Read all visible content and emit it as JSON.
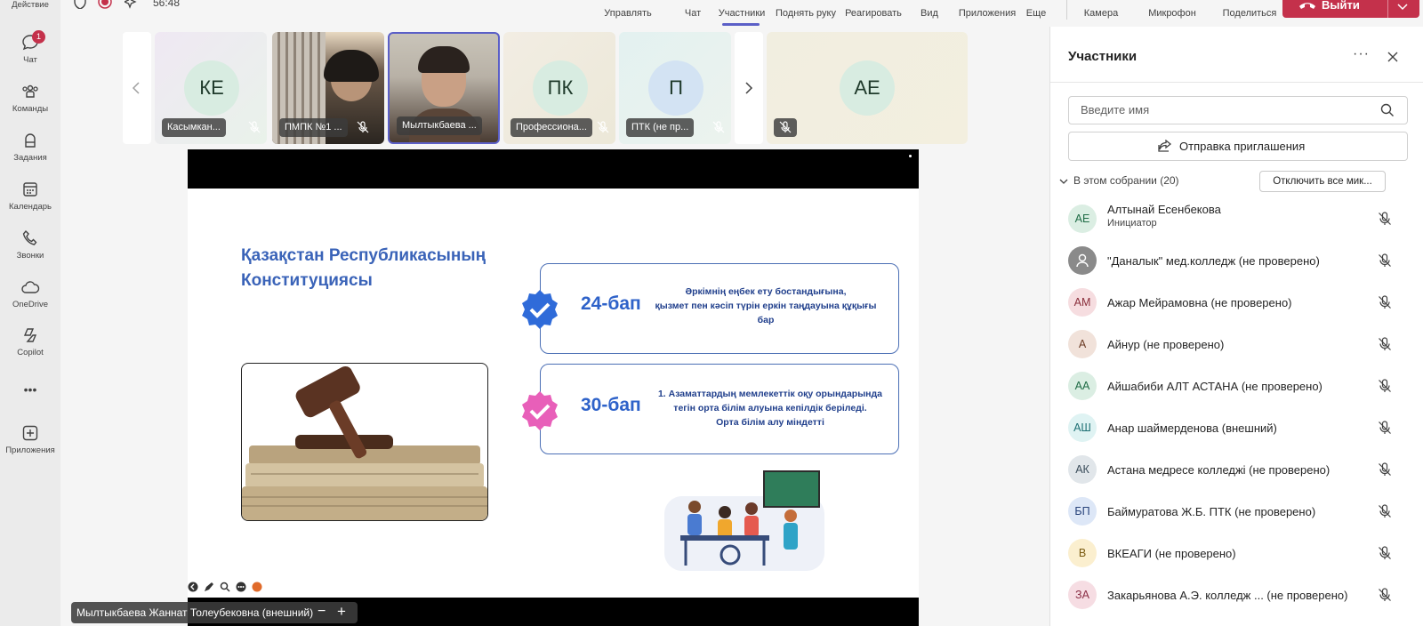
{
  "rail": {
    "items": [
      {
        "label": "Действие"
      },
      {
        "label": "Чат",
        "badge": "1"
      },
      {
        "label": "Команды"
      },
      {
        "label": "Задания"
      },
      {
        "label": "Календарь"
      },
      {
        "label": "Звонки"
      },
      {
        "label": "OneDrive"
      },
      {
        "label": "Copilot"
      },
      {
        "label": "•••"
      },
      {
        "label": "Приложения"
      }
    ]
  },
  "topbar": {
    "timer": "56:48",
    "items": [
      {
        "label": "Управлять"
      },
      {
        "label": "Чат"
      },
      {
        "label": "Участники"
      },
      {
        "label": "Поднять руку"
      },
      {
        "label": "Реагировать"
      },
      {
        "label": "Вид"
      },
      {
        "label": "Приложения"
      },
      {
        "label": "Еще"
      },
      {
        "label": "Камера"
      },
      {
        "label": "Микрофон"
      },
      {
        "label": "Поделиться"
      }
    ],
    "leave_label": "Выйти"
  },
  "strip": {
    "tiles": [
      {
        "initials": "КЕ",
        "name": "Касымкан..."
      },
      {
        "initials": "",
        "name": "ПМПК №1 ..."
      },
      {
        "initials": "",
        "name": "Мылтыкбаева ..."
      },
      {
        "initials": "ПК",
        "name": "Профессиона..."
      },
      {
        "initials": "П",
        "name": "ПТК (не пр..."
      },
      {
        "initials": "АЕ",
        "name": ""
      }
    ]
  },
  "slide": {
    "title_line1": "Қазақстан Республикасының",
    "title_line2": "Конституциясы",
    "art1": "24-бап",
    "art1_text_1": "Әркімнің еңбек ету бостандығына,",
    "art1_text_2": "қызмет пен кәсіп түрін еркін таңдауына құқығы",
    "art1_text_3": "бар",
    "art2": "30-бап",
    "art2_text_1": "1.    Азаматтардың мемлекеттік оқу орындарында",
    "art2_text_2": "тегін орта білім алуына кепілдік беріледі.",
    "art2_text_3": "Орта білім алу міндетті"
  },
  "presenter": {
    "name": "Мылтыкбаева Жаннат Толеубековна (внешний)"
  },
  "panel": {
    "title": "Участники",
    "search_placeholder": "Введите имя",
    "invite_label": "Отправка приглашения",
    "section_label": "В этом собрании (20)",
    "mute_all_label": "Отключить все мик...",
    "participants": [
      {
        "initials": "АЕ",
        "name": "Алтынай Есенбекова",
        "role": "Инициатор",
        "bg": "#dbeee3",
        "fg": "#1e6b45"
      },
      {
        "initials": "",
        "name": "\"Даналык\" мед.колледж (не проверено)",
        "role": "",
        "bg": "#8a8a8a",
        "fg": "#ffffff"
      },
      {
        "initials": "АМ",
        "name": "Ажар Мейрамовна (не проверено)",
        "role": "",
        "bg": "#f6dde0",
        "fg": "#8a2e3b"
      },
      {
        "initials": "А",
        "name": "Айнур (не проверено)",
        "role": "",
        "bg": "#f1e2da",
        "fg": "#6b3b24"
      },
      {
        "initials": "АА",
        "name": "Айшабиби АЛТ АСТАНА (не проверено)",
        "role": "",
        "bg": "#dbeee3",
        "fg": "#1e6b45"
      },
      {
        "initials": "АШ",
        "name": "Анар шаймерденова (внешний)",
        "role": "",
        "bg": "#dff3f3",
        "fg": "#1d6f73"
      },
      {
        "initials": "АК",
        "name": "Астана медресе колледжі (не проверено)",
        "role": "",
        "bg": "#e1e6ea",
        "fg": "#3a4c5a"
      },
      {
        "initials": "БП",
        "name": "Баймуратова Ж.Б. ПТК (не проверено)",
        "role": "",
        "bg": "#dde7f7",
        "fg": "#27427a"
      },
      {
        "initials": "В",
        "name": "ВКЕАГИ (не проверено)",
        "role": "",
        "bg": "#fbefcf",
        "fg": "#7a5a10"
      },
      {
        "initials": "ЗА",
        "name": "Закарьянова А.Э. колледж ...  (не проверено)",
        "role": "",
        "bg": "#f6dde3",
        "fg": "#8a2e45"
      }
    ]
  }
}
